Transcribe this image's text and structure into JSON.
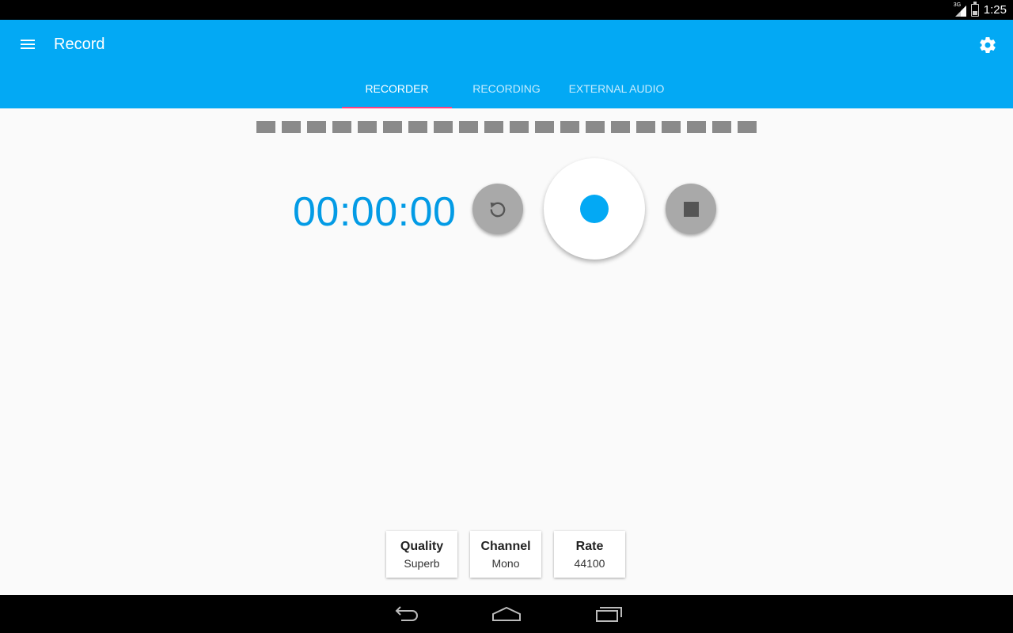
{
  "status_bar": {
    "network": "3G",
    "time": "1:25"
  },
  "app_bar": {
    "title": "Record",
    "tabs": [
      {
        "label": "RECORDER",
        "active": true
      },
      {
        "label": "RECORDING",
        "active": false
      },
      {
        "label": "EXTERNAL AUDIO",
        "active": false
      }
    ]
  },
  "recorder": {
    "level_segments": 20,
    "timer": "00:00:00",
    "accent_color": "#03a9f4"
  },
  "settings": [
    {
      "title": "Quality",
      "value": "Superb"
    },
    {
      "title": "Channel",
      "value": "Mono"
    },
    {
      "title": "Rate",
      "value": "44100"
    }
  ],
  "colors": {
    "app_bar": "#03a9f4",
    "tab_indicator": "#ff4081",
    "timer": "#039be5"
  }
}
